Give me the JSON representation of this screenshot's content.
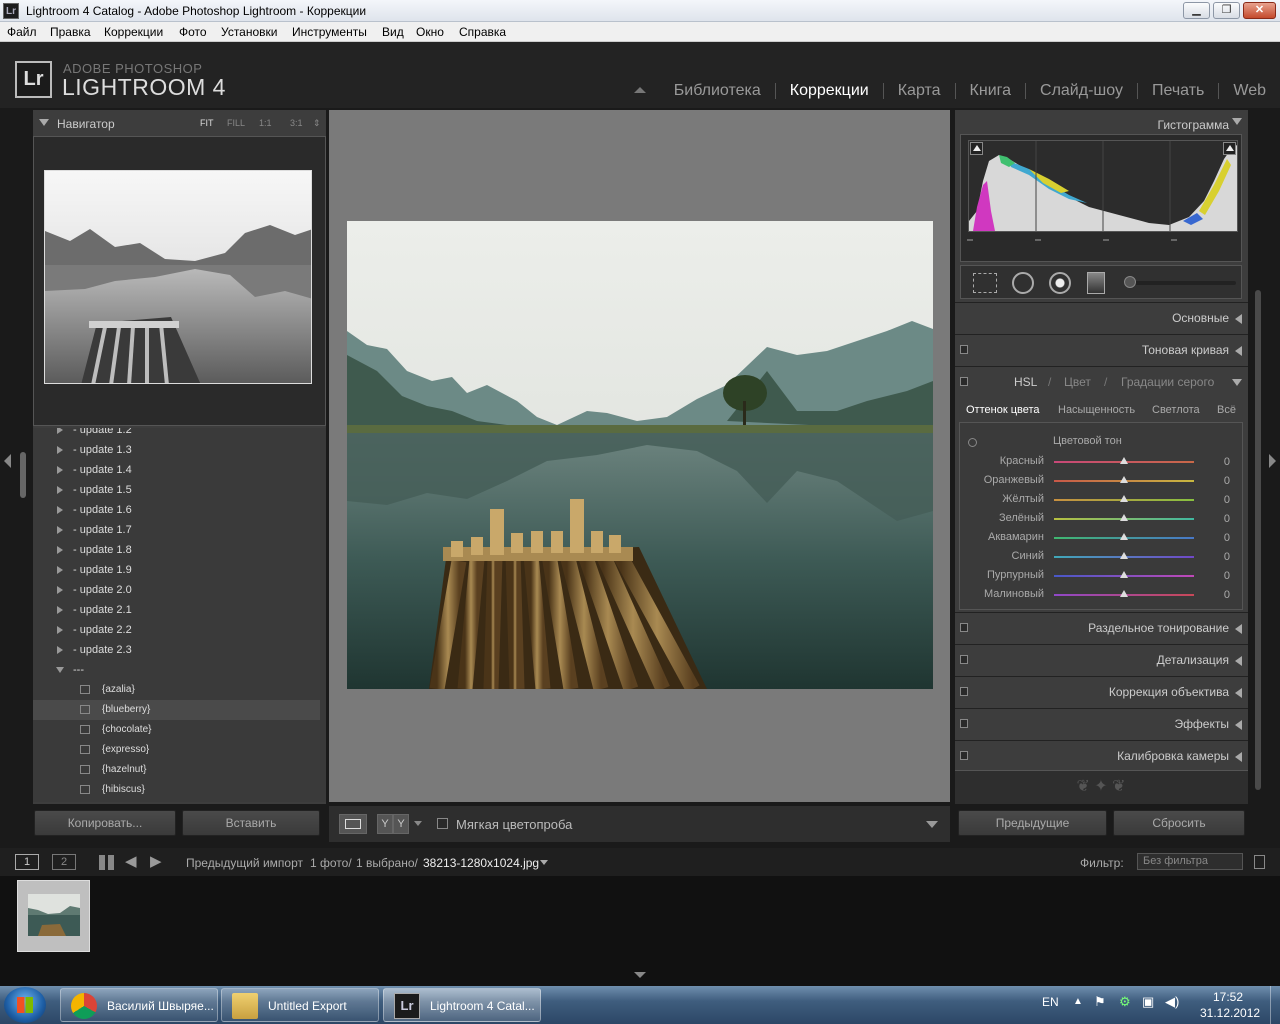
{
  "window": {
    "title": "Lightroom 4 Catalog - Adobe Photoshop Lightroom - Коррекции",
    "app_icon": "Lr",
    "minimize": "▁",
    "maximize": "❐",
    "close": "✕"
  },
  "menu": [
    "Файл",
    "Правка",
    "Коррекции",
    "Фото",
    "Установки",
    "Инструменты",
    "Вид",
    "Окно",
    "Справка"
  ],
  "header": {
    "logo": "Lr",
    "brand_small": "ADOBE PHOTOSHOP",
    "brand_large": "LIGHTROOM 4",
    "modules": [
      "Библиотека",
      "Коррекции",
      "Карта",
      "Книга",
      "Слайд-шоу",
      "Печать",
      "Web"
    ],
    "active_module": "Коррекции"
  },
  "navigator": {
    "title": "Навигатор",
    "zoom": [
      "FIT",
      "FILL",
      "1:1",
      "3:1"
    ],
    "active_zoom": "FIT"
  },
  "collections": {
    "partial_top": "- update 1.2",
    "items": [
      "- update 1.3",
      "- update 1.4",
      "- update 1.5",
      "- update 1.6",
      "- update 1.7",
      "- update 1.8",
      "- update 1.9",
      "- update 2.0",
      "- update 2.1",
      "- update 2.2",
      "- update 2.3"
    ],
    "expanded": "---",
    "presets": [
      "{azalia}",
      "{blueberry}",
      "{chocolate}",
      "{expresso}",
      "{hazelnut}",
      "{hibiscus}"
    ],
    "highlighted": "{blueberry}"
  },
  "left_buttons": {
    "copy": "Копировать...",
    "paste": "Вставить"
  },
  "toolbar": {
    "yy1": "Y",
    "yy2": "Y",
    "softproof": "Мягкая цветопроба"
  },
  "right_panel": {
    "histogram": "Гистограмма",
    "sections_top": [
      "Основные",
      "Тоновая кривая"
    ],
    "hsl_header": {
      "hsl": "HSL",
      "sep": "/",
      "color": "Цвет",
      "gray": "Градации серого"
    },
    "hsl_tabs": [
      "Оттенок цвета",
      "Насыщенность",
      "Светлота",
      "Всё"
    ],
    "hsl_active": "Оттенок цвета",
    "hue_title": "Цветовой тон",
    "sliders": [
      {
        "label": "Красный",
        "value": "0",
        "color": "#c84848"
      },
      {
        "label": "Оранжевый",
        "value": "0",
        "color": "#d08a3a"
      },
      {
        "label": "Жёлтый",
        "value": "0",
        "color": "#c8c040"
      },
      {
        "label": "Зелёный",
        "value": "0",
        "color": "#58b048"
      },
      {
        "label": "Аквамарин",
        "value": "0",
        "color": "#40b0b0"
      },
      {
        "label": "Синий",
        "value": "0",
        "color": "#4868c8"
      },
      {
        "label": "Пурпурный",
        "value": "0",
        "color": "#8848c8"
      },
      {
        "label": "Малиновый",
        "value": "0",
        "color": "#c848a0"
      }
    ],
    "sections_bottom": [
      "Раздельное тонирование",
      "Детализация",
      "Коррекция объектива",
      "Эффекты",
      "Калибровка камеры"
    ]
  },
  "right_buttons": {
    "previous": "Предыдущие",
    "reset": "Сбросить"
  },
  "filmstrip_bar": {
    "page1": "1",
    "page2": "2",
    "source": "Предыдущий импорт",
    "count": "1 фото/",
    "selected": "1 выбрано/",
    "filename": "38213-1280x1024.jpg",
    "filter_label": "Фильтр:",
    "filter_value": "Без фильтра"
  },
  "taskbar": {
    "items": [
      "Василий Швыряе...",
      "Untitled Export",
      "Lightroom 4 Catal..."
    ],
    "lang": "EN",
    "time": "17:52",
    "date": "31.12.2012"
  }
}
